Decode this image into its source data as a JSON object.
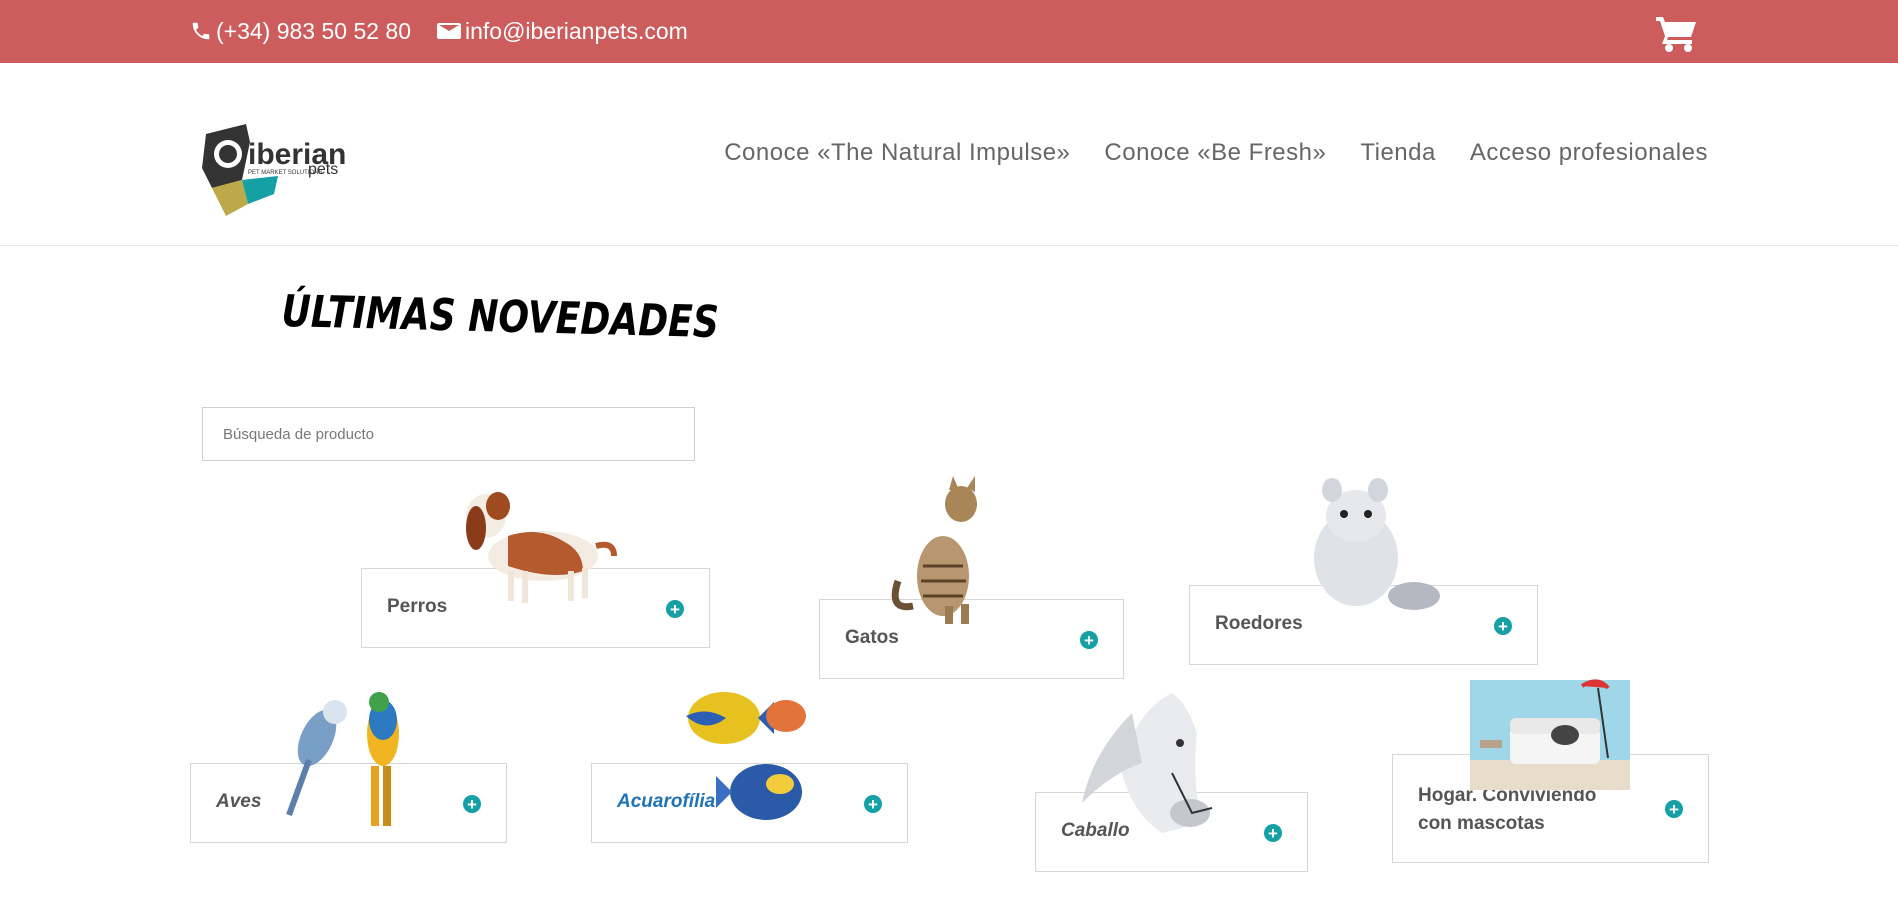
{
  "topbar": {
    "phone": "(+34) 983 50 52 80",
    "email": "info@iberianpets.com",
    "background": "#cd5c5c"
  },
  "logo": {
    "brand_primary": "iberian",
    "brand_secondary": "pets",
    "tagline": "PET MARKET SOLUTIONS"
  },
  "nav": {
    "items": [
      "Conoce «The Natural Impulse»",
      "Conoce «Be Fresh»",
      "Tienda",
      "Acceso profesionales"
    ]
  },
  "main": {
    "title": "ÚLTIMAS NOVEDADES",
    "search_placeholder": "Búsqueda de producto"
  },
  "categories": [
    {
      "label": "Perros",
      "icon": "dog-illustration"
    },
    {
      "label": "Gatos",
      "icon": "cat-illustration"
    },
    {
      "label": "Roedores",
      "icon": "chinchilla-illustration"
    },
    {
      "label": "Aves",
      "icon": "parrots-illustration"
    },
    {
      "label": "Acuarofília",
      "icon": "fish-illustration"
    },
    {
      "label": "Caballo",
      "icon": "horse-illustration"
    },
    {
      "label_line1": "Hogar. Conviviendo",
      "label_line2": "con mascotas",
      "icon": "living-room-illustration"
    }
  ],
  "colors": {
    "accent_teal": "#14a0a4",
    "link_blue": "#1f74b7",
    "nav_text": "#666666"
  }
}
